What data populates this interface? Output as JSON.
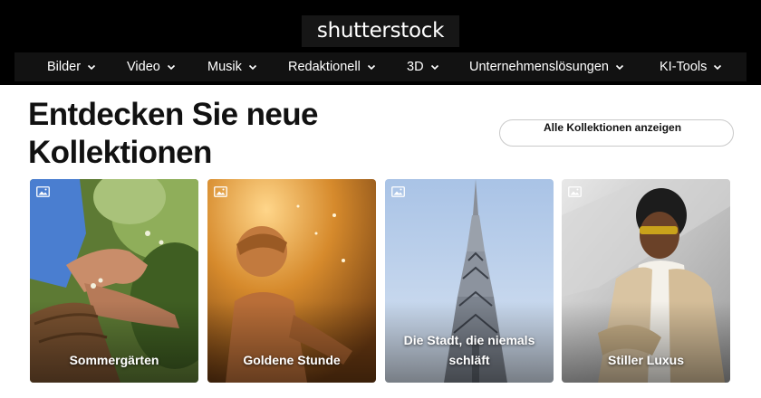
{
  "header": {
    "logo_text": "shutterstock",
    "nav": [
      {
        "label": "Bilder",
        "icon": "chevron-down-icon"
      },
      {
        "label": "Video",
        "icon": "chevron-down-icon"
      },
      {
        "label": "Musik",
        "icon": "chevron-down-icon"
      },
      {
        "label": "Redaktionell",
        "icon": "chevron-down-icon"
      },
      {
        "label": "3D",
        "icon": "chevron-down-icon"
      },
      {
        "label": "Unternehmenslösungen",
        "icon": "chevron-down-icon"
      },
      {
        "label": "KI-Tools",
        "icon": "chevron-down-icon"
      }
    ]
  },
  "main": {
    "title_line1": "Entdecken Sie neue",
    "title_line2": "Kollektionen",
    "all_collections_button": "Alle Kollektionen anzeigen",
    "cards": [
      {
        "label": "Sommergärten",
        "icon": "image-icon"
      },
      {
        "label": "Goldene Stunde",
        "icon": "image-icon"
      },
      {
        "label": "Die Stadt, die niemals schläft",
        "icon": "image-icon"
      },
      {
        "label": "Stiller Luxus",
        "icon": "image-icon"
      }
    ]
  },
  "colors": {
    "header_bg": "#000000",
    "nav_bg": "#121212",
    "text": "#111111",
    "button_border": "#c9c9c9"
  }
}
